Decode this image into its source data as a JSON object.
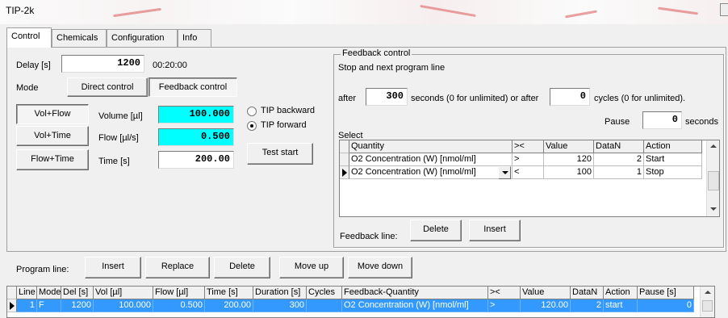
{
  "window": {
    "title": "TIP-2k"
  },
  "tabs": [
    {
      "label": "Control"
    },
    {
      "label": "Chemicals"
    },
    {
      "label": "Configuration"
    },
    {
      "label": "Info"
    }
  ],
  "control": {
    "delay_label": "Delay [s]",
    "delay_value": "1200",
    "delay_time": "00:20:00",
    "mode_label": "Mode",
    "direct_control": "Direct control",
    "feedback_control": "Feedback control",
    "vol_flow": "Vol+Flow",
    "vol_time": "Vol+Time",
    "flow_time": "Flow+Time",
    "volume_label": "Volume [µl]",
    "volume_value": "100.000",
    "flow_label": "Flow [µl/s]",
    "flow_value": "0.500",
    "time_label": "Time [s]",
    "time_value": "200.00",
    "tip_backward": "TIP backward",
    "tip_forward": "TIP forward",
    "test_start": "Test start"
  },
  "feedback": {
    "group_title": "Feedback control",
    "stop_next": "Stop and next program line",
    "after_label": "after",
    "seconds_value": "300",
    "seconds_text": "seconds (0 for unlimited) or after",
    "cycles_value": "0",
    "cycles_text": "cycles (0 for unlimited).",
    "pause_label": "Pause",
    "pause_value": "0",
    "pause_unit": "seconds",
    "select_label": "Select",
    "columns": [
      "Quantity",
      "><",
      "Value",
      "DataN",
      "Action"
    ],
    "rows": [
      {
        "quantity": "O2 Concentration (W) [nmol/ml]",
        "op": ">",
        "value": "120",
        "datan": "2",
        "action": "Start"
      },
      {
        "quantity": "O2 Concentration (W) [nmol/ml]",
        "op": "<",
        "value": "100",
        "datan": "1",
        "action": "Stop"
      }
    ],
    "feedback_line_label": "Feedback line:",
    "delete": "Delete",
    "insert": "Insert"
  },
  "program": {
    "label": "Program line:",
    "insert": "Insert",
    "replace": "Replace",
    "delete": "Delete",
    "move_up": "Move up",
    "move_down": "Move down",
    "columns": [
      "Line",
      "Mode",
      "Del [s]",
      "Vol [µl]",
      "Flow [µl]",
      "Time [s]",
      "Duration [s]",
      "Cycles",
      "Feedback-Quantity",
      "><",
      "Value",
      "DataN",
      "Action",
      "Pause [s]"
    ],
    "rows": [
      {
        "line": "1",
        "mode": "F",
        "del": "1200",
        "vol": "100.000",
        "flow": "0.500",
        "time": "200.00",
        "duration": "300",
        "cycles": "",
        "fq": "O2 Concentration (W) [nmol/ml]",
        "op": ">",
        "value": "120.00",
        "datan": "2",
        "action": "start",
        "pause": "0"
      }
    ]
  },
  "colors": {
    "highlight": "#00ffff",
    "selection": "#3399ff"
  }
}
